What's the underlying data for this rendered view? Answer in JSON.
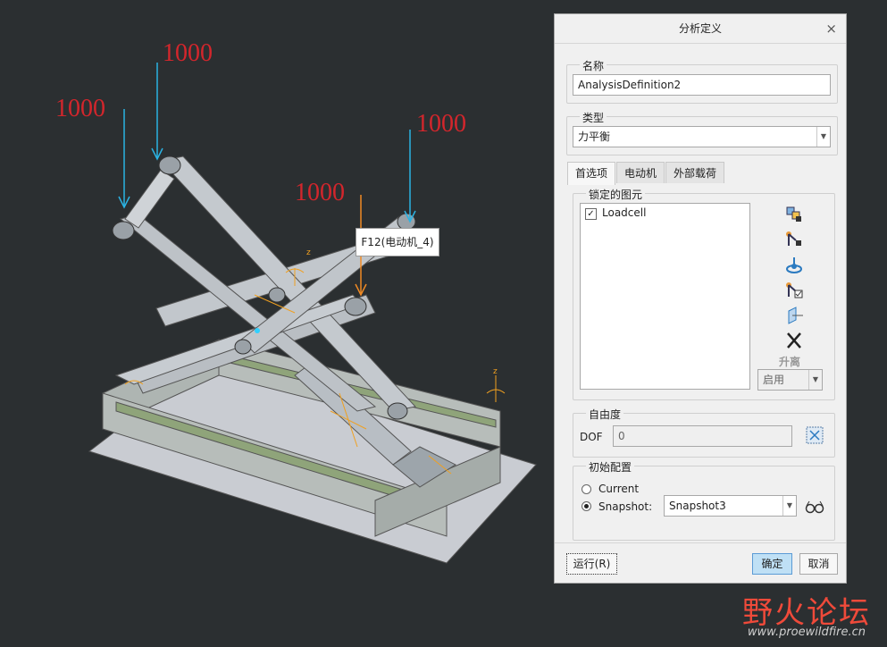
{
  "viewport": {
    "force_labels": [
      "1000",
      "1000",
      "1000",
      "1000"
    ],
    "tooltip": "F12(电动机_4)"
  },
  "dialog": {
    "title": "分析定义",
    "close": "×",
    "name_group_label": "名称",
    "name_value": "AnalysisDefinition2",
    "type_group_label": "类型",
    "type_value": "力平衡",
    "tabs": [
      "首选项",
      "电动机",
      "外部载荷"
    ],
    "locked_group_label": "锁定的图元",
    "locked_items": [
      {
        "label": "Loadcell",
        "checked": true
      }
    ],
    "lift_label": "升离",
    "enable_value": "启用",
    "dof_group_label": "自由度",
    "dof_label": "DOF",
    "dof_value": "0",
    "init_group_label": "初始配置",
    "current_label": "Current",
    "snapshot_label": "Snapshot:",
    "snapshot_value": "Snapshot3",
    "run_button": "运行(R)",
    "ok_button": "确定",
    "cancel_button": "取消"
  },
  "watermark": {
    "brand": "野火论坛",
    "url": "www.proewildfire.cn"
  },
  "colors": {
    "background": "#2b2f31",
    "force_label": "#d3262c",
    "force_arrow": "#2bb3e3",
    "motor_arrow": "#f08a24",
    "ok_button": "#bfe0f5"
  }
}
